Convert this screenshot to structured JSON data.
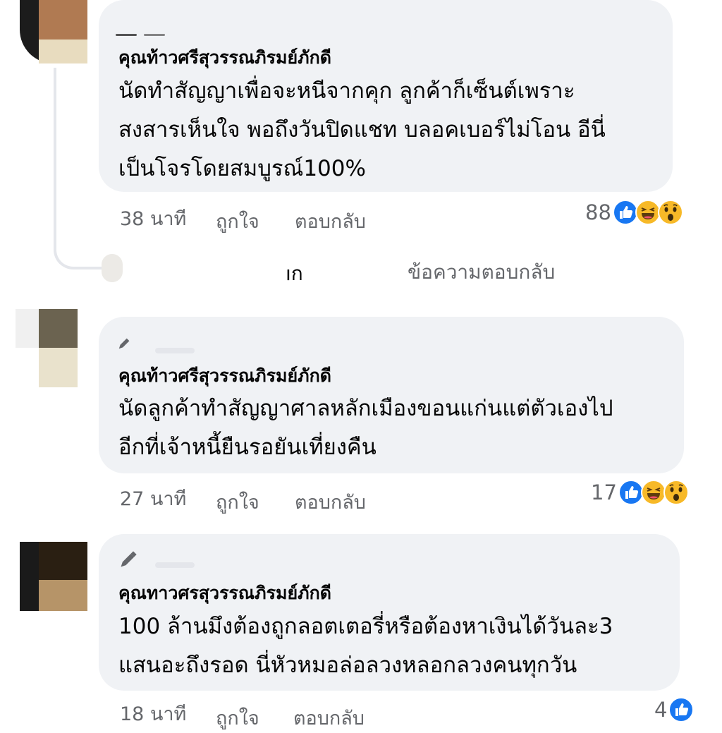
{
  "comments": [
    {
      "author": "คุณท้าวศรีสุวรรณภิรมย์ภักดี",
      "lines": [
        "นัดทำสัญญาเพื่อจะหนีจากคุก ลูกค้าก็เซ็นต์เพราะ",
        "สงสารเห็นใจ พอถึงวันปิดแชท บลอคเบอร์ไม่โอน อีนี่",
        "เป็นโจรโดยสมบูรณ์100%"
      ],
      "time": "38 นาที",
      "like_label": "ถูกใจ",
      "reply_label": "ตอบกลับ",
      "reaction_count": "88",
      "reactions": [
        "like-icon",
        "haha-icon",
        "wow-icon"
      ],
      "avatar_colors": [
        "#b07a52",
        "#e8dcbf"
      ]
    },
    {
      "author": "คุณท้าวศรีสุวรรณภิรมย์ภักดี",
      "lines": [
        "นัดลูกค้าทำสัญญาศาลหลักเมืองขอนแก่นแต่ตัวเองไป",
        "อีกที่เจ้าหนี้ยืนรอยันเที่ยงคืน"
      ],
      "time": "27 นาที",
      "like_label": "ถูกใจ",
      "reply_label": "ตอบกลับ",
      "reaction_count": "17",
      "reactions": [
        "like-icon",
        "haha-icon",
        "wow-icon"
      ],
      "avatar_colors": [
        "#6b6350",
        "#e9e2cc"
      ]
    },
    {
      "author": "คุณทาวศรสุวรรณภิรมย์ภักดี",
      "lines": [
        "100 ล้านมึงต้องถูกลอตเตอรี่หรือต้องหาเงินได้วันละ3",
        "แสนอะถึงรอด นี่หัวหมอล่อลวงหลอกลวงคนทุกวัน"
      ],
      "time": "18 นาที",
      "like_label": "ถูกใจ",
      "reply_label": "ตอบกลับ",
      "reaction_count": "4",
      "reactions": [
        "like-icon"
      ],
      "avatar_colors": [
        "#2a1f12",
        "#b69468"
      ]
    }
  ],
  "reply_preview": {
    "name_fragment": "ıก",
    "label": "ข้อความตอบกลับ"
  },
  "colors": {
    "bubble": "#f0f2f5",
    "secondary_text": "#65676b",
    "like_blue": "#1877f2",
    "emoji_yellow": "#f7b928"
  }
}
